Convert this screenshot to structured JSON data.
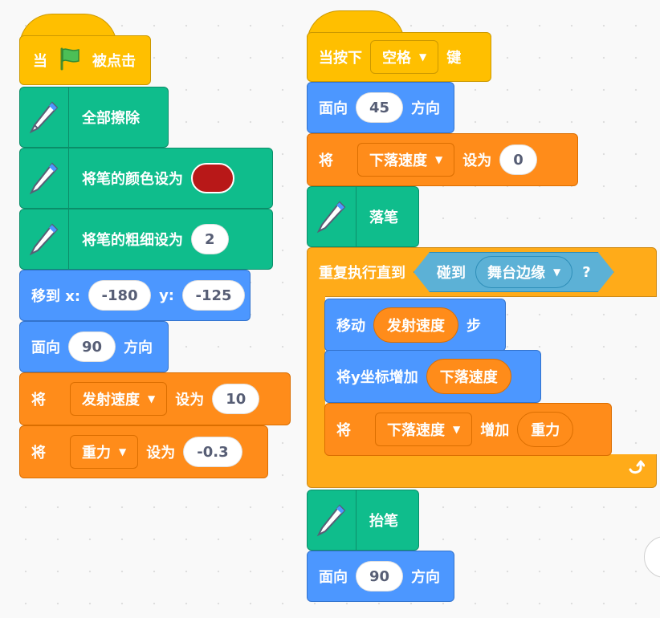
{
  "script1": {
    "when_flag": {
      "prefix": "当",
      "suffix": "被点击"
    },
    "erase_all": "全部擦除",
    "set_pen_color": "将笔的颜色设为",
    "pen_color": "#b81818",
    "set_pen_size": "将笔的粗细设为",
    "pen_size": "2",
    "goto": {
      "label": "移到 x:",
      "x": "-180",
      "ylabel": "y:",
      "y": "-125"
    },
    "point": {
      "label": "面向",
      "value": "90",
      "suffix": "方向"
    },
    "set_var1": {
      "prefix": "将",
      "var": "发射速度",
      "mid": "设为",
      "value": "10"
    },
    "set_var2": {
      "prefix": "将",
      "var": "重力",
      "mid": "设为",
      "value": "-0.3"
    }
  },
  "script2": {
    "when_key": {
      "prefix": "当按下",
      "key": "空格",
      "suffix": "键"
    },
    "point1": {
      "label": "面向",
      "value": "45",
      "suffix": "方向"
    },
    "set_var": {
      "prefix": "将",
      "var": "下落速度",
      "mid": "设为",
      "value": "0"
    },
    "pen_down": "落笔",
    "repeat_until": {
      "label": "重复执行直到",
      "touching": "碰到",
      "target": "舞台边缘",
      "q": "?"
    },
    "move": {
      "label": "移动",
      "reporter": "发射速度",
      "suffix": "步"
    },
    "change_y": {
      "label": "将y坐标增加",
      "reporter": "下落速度"
    },
    "change_var": {
      "prefix": "将",
      "var": "下落速度",
      "mid": "增加",
      "reporter": "重力"
    },
    "pen_up": "抬笔",
    "point2": {
      "label": "面向",
      "value": "90",
      "suffix": "方向"
    }
  },
  "colors": {
    "event": "#ffbf00",
    "pen": "#0fbd8c",
    "motion": "#4c97ff",
    "variables": "#ff8c1a",
    "control": "#ffab19",
    "sensing": "#5cb1d6"
  }
}
